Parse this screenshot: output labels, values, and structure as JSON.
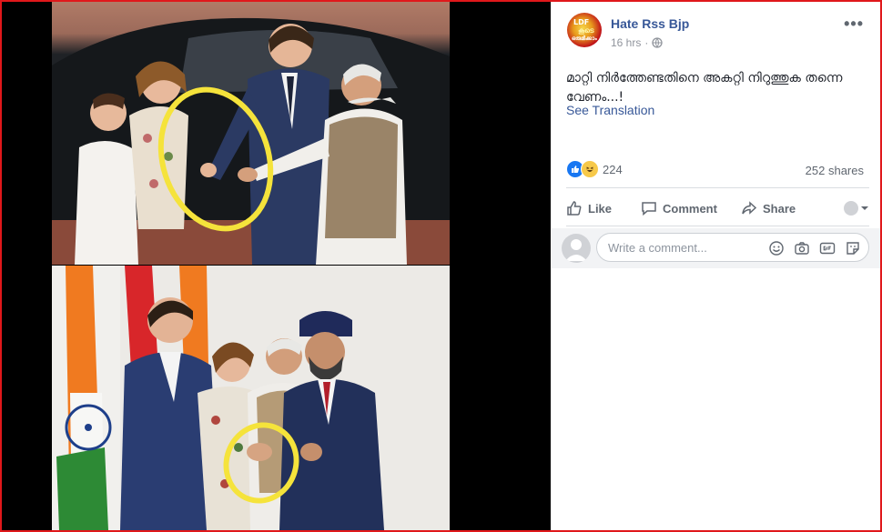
{
  "post": {
    "page_name": "Hate Rss Bjp",
    "time": "16 hrs",
    "separator": "·",
    "text": "മാറ്റി നിർത്തേണ്ടതിനെ അകറ്റി നിറുത്തുക തന്നെ വേണം...!",
    "see_translation": "See Translation",
    "avatar_text": {
      "line1": "LDF",
      "line2": "കൂടെ",
      "line3": "ഒരുമിക്കാം"
    },
    "more_label": "•••"
  },
  "reactions": {
    "count": "224",
    "shares": "252 shares",
    "icons": [
      "like-icon",
      "haha-icon"
    ]
  },
  "actions": {
    "like": "Like",
    "comment": "Comment",
    "share": "Share"
  },
  "comment_box": {
    "placeholder": "Write a comment..."
  },
  "colors": {
    "frame": "#e0181b",
    "link": "#385898",
    "muted": "#606770",
    "highlight_circle": "#f5e33b"
  }
}
